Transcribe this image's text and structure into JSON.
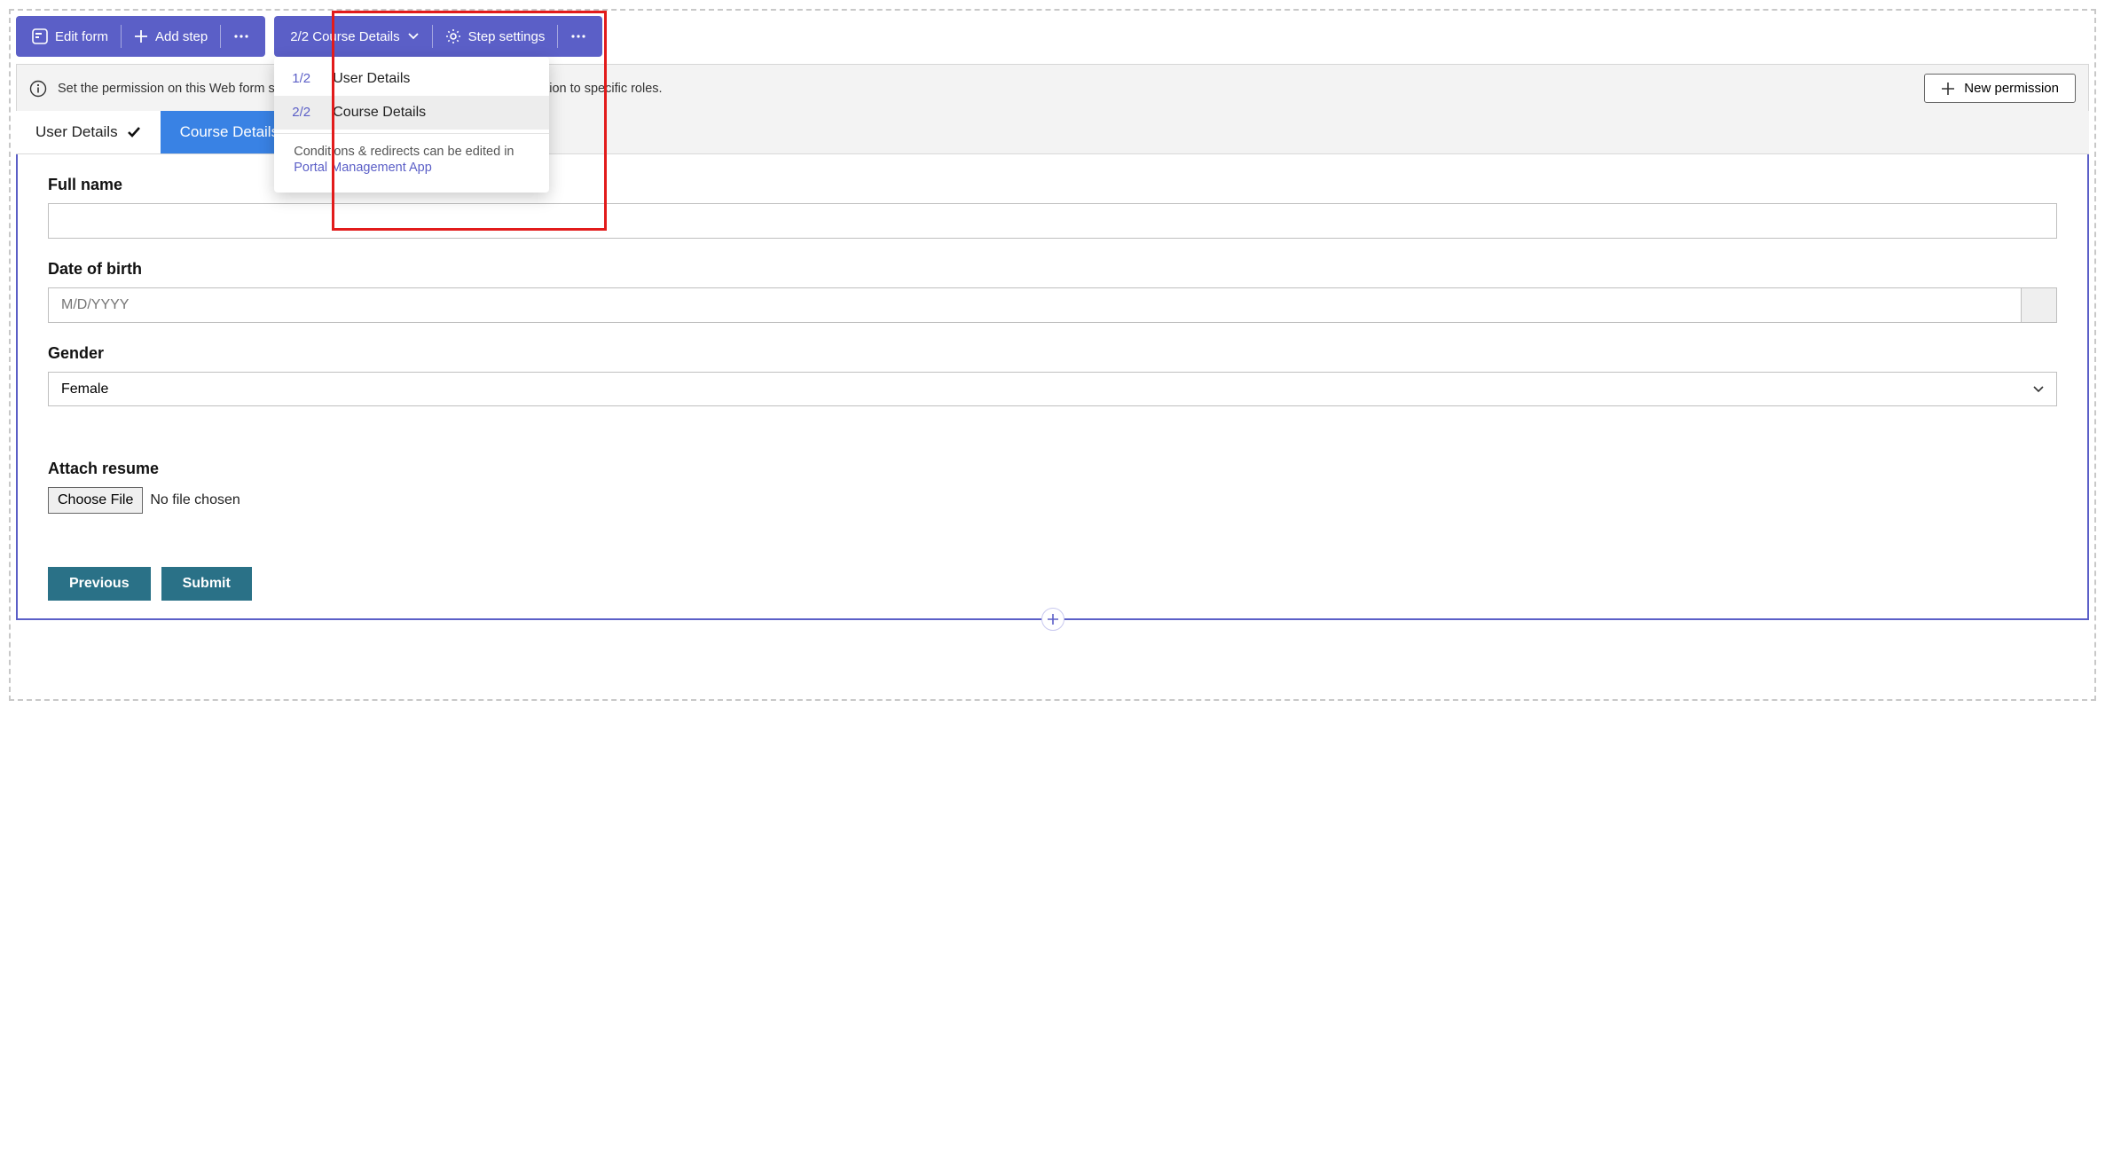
{
  "toolbar": {
    "edit_form": "Edit form",
    "add_step": "Add step",
    "step_counter": "2/2 Course Details",
    "step_settings": "Step settings"
  },
  "dropdown": {
    "items": [
      {
        "num": "1/2",
        "label": "User Details"
      },
      {
        "num": "2/2",
        "label": "Course Details"
      }
    ],
    "footer_text": "Conditions & redirects can be edited in",
    "footer_link": "Portal Management App"
  },
  "permission": {
    "message": "Set the permission on this Web form so it can be viewed by anyone or limit the interaction to specific roles.",
    "new_btn": "New permission"
  },
  "tabs": [
    {
      "label": "User Details",
      "state": "completed"
    },
    {
      "label": "Course Details",
      "state": "active"
    }
  ],
  "form": {
    "full_name": {
      "label": "Full name",
      "value": ""
    },
    "dob": {
      "label": "Date of birth",
      "placeholder": "M/D/YYYY",
      "value": ""
    },
    "gender": {
      "label": "Gender",
      "value": "Female"
    },
    "resume": {
      "label": "Attach resume",
      "button": "Choose File",
      "status": "No file chosen"
    }
  },
  "actions": {
    "previous": "Previous",
    "submit": "Submit"
  }
}
